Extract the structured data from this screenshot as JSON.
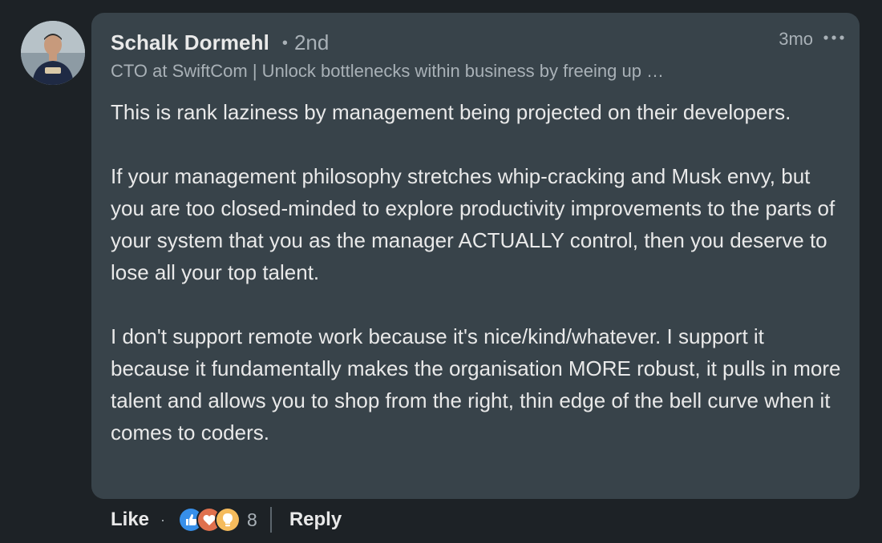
{
  "author": {
    "name": "Schalk Dormehl",
    "connection": "2nd",
    "headline": "CTO at SwiftCom | Unlock bottlenecks within business by freeing up …"
  },
  "comment": {
    "time": "3mo",
    "paragraphs": [
      "This is rank laziness by management being projected on their developers.",
      "If your management philosophy stretches whip-cracking and Musk envy, but you are too closed-minded to explore productivity improvements to the parts of your system that you as the manager ACTUALLY control, then you deserve to lose all your top talent.",
      "I don't support remote work because it's nice/kind/whatever. I support it because it fundamentally makes the organisation MORE robust, it pulls in more talent and allows you to shop from the right, thin edge of the bell curve when it comes to coders."
    ]
  },
  "actions": {
    "like_label": "Like",
    "separator": "·",
    "reaction_count": "8",
    "reply_label": "Reply",
    "reactions": [
      "like-icon",
      "love-icon",
      "insightful-icon"
    ]
  },
  "colors": {
    "background": "#1d2226",
    "bubble": "#38434a",
    "text_primary": "#e9e9e9",
    "text_secondary": "#a9b1b7",
    "like_blue": "#378fe9",
    "love_red": "#df704d",
    "insightful_yellow": "#f5bb5c"
  }
}
